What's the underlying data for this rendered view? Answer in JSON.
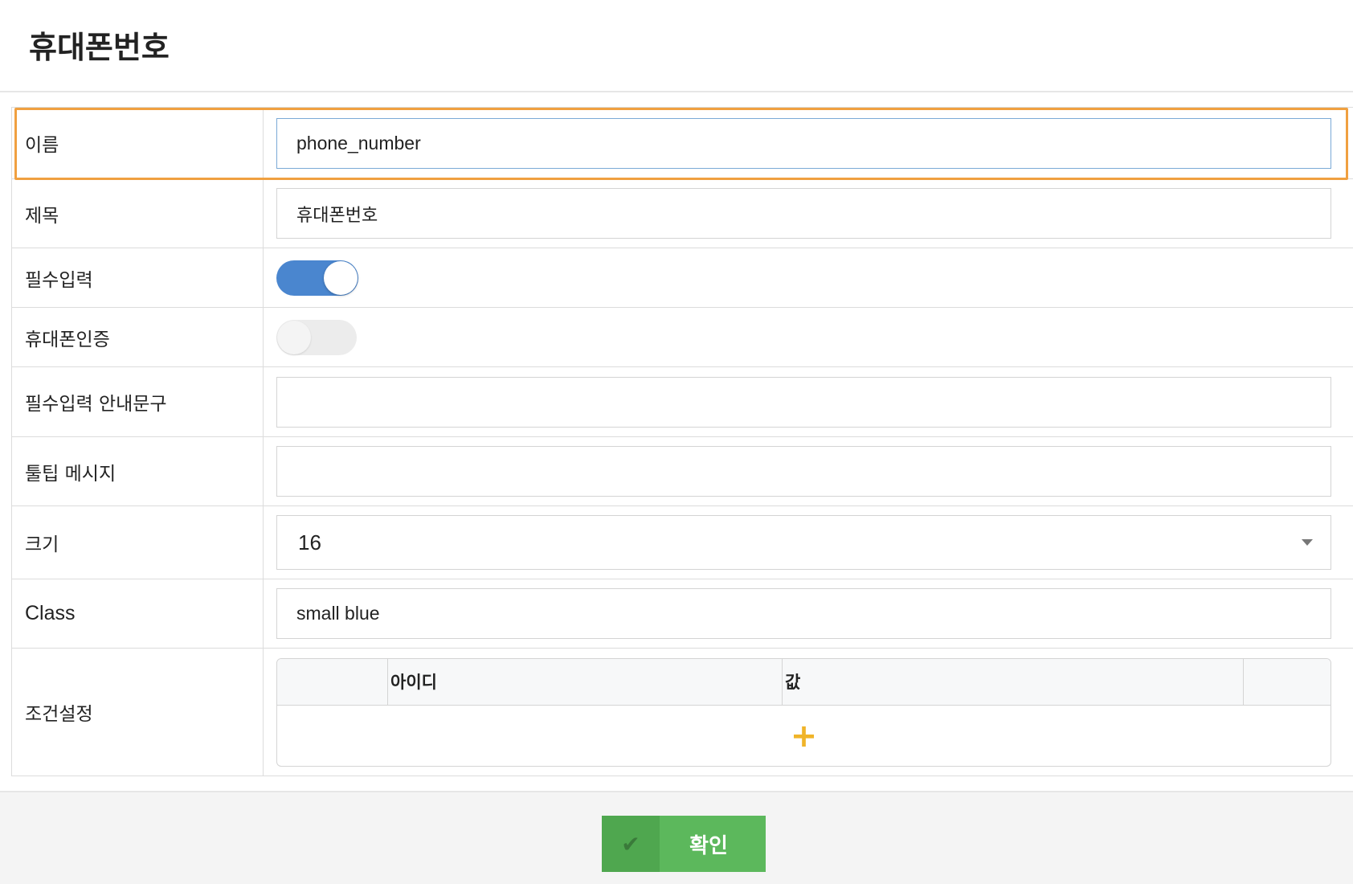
{
  "header": {
    "title": "휴대폰번호"
  },
  "form": {
    "name": {
      "label": "이름",
      "value": "phone_number"
    },
    "title": {
      "label": "제목",
      "value": "휴대폰번호"
    },
    "required": {
      "label": "필수입력",
      "enabled": true
    },
    "phone_auth": {
      "label": "휴대폰인증",
      "enabled": false
    },
    "required_guide": {
      "label": "필수입력 안내문구",
      "value": ""
    },
    "tooltip": {
      "label": "툴팁 메시지",
      "value": ""
    },
    "size": {
      "label": "크기",
      "selected": "16"
    },
    "class": {
      "label": "Class",
      "value": "small blue"
    },
    "condition": {
      "label": "조건설정",
      "columns": [
        "",
        "아이디",
        "값",
        ""
      ],
      "add_icon": "plus-icon",
      "add_symbol": "+"
    }
  },
  "footer": {
    "confirm_label": "확인",
    "confirm_icon": "check-icon"
  },
  "colors": {
    "highlight": "#f0a040",
    "toggle_on": "#4a86cf",
    "confirm": "#5cb85c",
    "plus": "#f0b429"
  }
}
